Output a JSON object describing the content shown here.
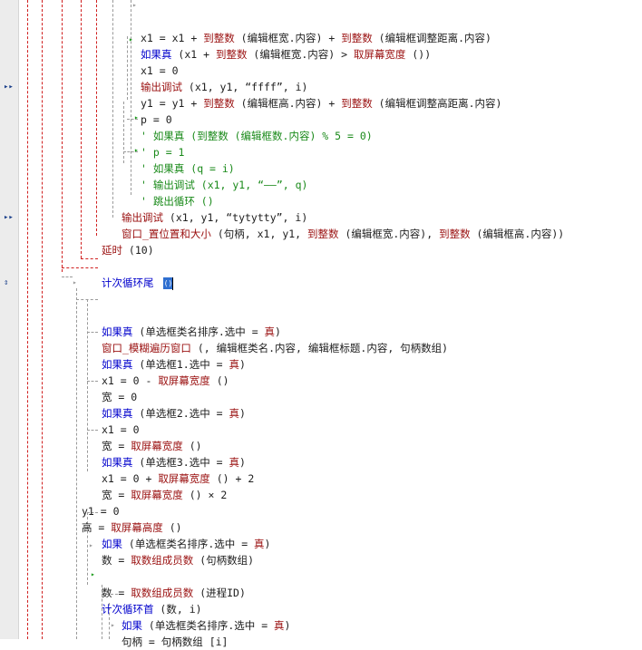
{
  "editor": {
    "gutter_markers": [
      {
        "row": 4,
        "icon": "run-marker-icon",
        "glyph": "▸▸"
      },
      {
        "row": 12,
        "icon": "run-marker-icon",
        "glyph": "▸▸"
      },
      {
        "row": 16,
        "icon": "cursor-line-marker-icon",
        "glyph": "⇕"
      }
    ],
    "lines": [
      {
        "id": "l0",
        "indent": 155,
        "parts": [
          {
            "c": "t",
            "v": ""
          }
        ]
      },
      {
        "id": "l1",
        "indent": 155,
        "parts": [
          {
            "c": "t",
            "v": "x1 = x1 + "
          },
          {
            "c": "f",
            "v": "到整数"
          },
          {
            "c": "t",
            "v": " (编辑框宽.内容) + "
          },
          {
            "c": "f",
            "v": "到整数"
          },
          {
            "c": "t",
            "v": " (编辑框调整距离.内容)"
          }
        ]
      },
      {
        "id": "l2",
        "indent": 155,
        "parts": [
          {
            "c": "k",
            "v": "如果真"
          },
          {
            "c": "t",
            "v": " (x1 + "
          },
          {
            "c": "f",
            "v": "到整数"
          },
          {
            "c": "t",
            "v": " (编辑框宽.内容) > "
          },
          {
            "c": "f",
            "v": "取屏幕宽度"
          },
          {
            "c": "t",
            "v": " ())"
          }
        ]
      },
      {
        "id": "l3",
        "indent": 155,
        "parts": [
          {
            "c": "t",
            "v": "x1 = 0"
          }
        ]
      },
      {
        "id": "l4",
        "indent": 155,
        "parts": [
          {
            "c": "f",
            "v": "输出调试"
          },
          {
            "c": "t",
            "v": " (x1, y1, “ffff”, i)"
          }
        ]
      },
      {
        "id": "l5",
        "indent": 155,
        "parts": [
          {
            "c": "t",
            "v": "y1 = y1 + "
          },
          {
            "c": "f",
            "v": "到整数"
          },
          {
            "c": "t",
            "v": " (编辑框高.内容) + "
          },
          {
            "c": "f",
            "v": "到整数"
          },
          {
            "c": "t",
            "v": " (编辑框调整高距离.内容)"
          }
        ]
      },
      {
        "id": "l6",
        "indent": 155,
        "parts": [
          {
            "c": "t",
            "v": "p = 0"
          }
        ]
      },
      {
        "id": "l7",
        "indent": 155,
        "parts": [
          {
            "c": "c",
            "v": "' 如果真 (到整数 (编辑框数.内容) % 5 = 0)"
          }
        ]
      },
      {
        "id": "l8",
        "indent": 155,
        "parts": [
          {
            "c": "c",
            "v": "' p = 1"
          }
        ]
      },
      {
        "id": "l9",
        "indent": 155,
        "parts": [
          {
            "c": "c",
            "v": "' 如果真 (q = i)"
          }
        ]
      },
      {
        "id": "l10",
        "indent": 155,
        "parts": [
          {
            "c": "c",
            "v": "' 输出调试 (x1, y1, “——”, q)"
          }
        ]
      },
      {
        "id": "l11",
        "indent": 155,
        "parts": [
          {
            "c": "c",
            "v": "' 跳出循环 ()"
          }
        ]
      },
      {
        "id": "l12",
        "indent": 134,
        "parts": [
          {
            "c": "f",
            "v": "输出调试"
          },
          {
            "c": "t",
            "v": " (x1, y1, “tytytty”, i)"
          }
        ]
      },
      {
        "id": "l13",
        "indent": 134,
        "parts": [
          {
            "c": "f",
            "v": "窗口_置位置和大小"
          },
          {
            "c": "t",
            "v": " (句柄, x1, y1, "
          },
          {
            "c": "f",
            "v": "到整数"
          },
          {
            "c": "t",
            "v": " (编辑框宽.内容), "
          },
          {
            "c": "f",
            "v": "到整数"
          },
          {
            "c": "t",
            "v": " (编辑框高.内容))"
          }
        ]
      },
      {
        "id": "l14",
        "indent": 112,
        "parts": [
          {
            "c": "f",
            "v": "延时"
          },
          {
            "c": "t",
            "v": " (10)"
          }
        ]
      },
      {
        "id": "l15",
        "indent": 112,
        "parts": [
          {
            "c": "t",
            "v": ""
          }
        ]
      },
      {
        "id": "l16",
        "indent": 112,
        "parts": [
          {
            "c": "k",
            "v": "计次循环尾"
          },
          {
            "c": "t",
            "v": " "
          }
        ],
        "cursor": true
      },
      {
        "id": "l17",
        "indent": 112,
        "parts": [
          {
            "c": "t",
            "v": ""
          }
        ]
      },
      {
        "id": "l18",
        "indent": 112,
        "parts": [
          {
            "c": "t",
            "v": ""
          }
        ]
      },
      {
        "id": "l19",
        "indent": 112,
        "parts": [
          {
            "c": "k",
            "v": "如果真"
          },
          {
            "c": "t",
            "v": " (单选框类名排序.选中 = "
          },
          {
            "c": "f",
            "v": "真"
          },
          {
            "c": "t",
            "v": ")"
          }
        ]
      },
      {
        "id": "l20",
        "indent": 112,
        "parts": [
          {
            "c": "f",
            "v": "窗口_模糊遍历窗口"
          },
          {
            "c": "t",
            "v": " (, 编辑框类名.内容, 编辑框标题.内容, 句柄数组)"
          }
        ]
      },
      {
        "id": "l21",
        "indent": 112,
        "parts": [
          {
            "c": "k",
            "v": "如果真"
          },
          {
            "c": "t",
            "v": " (单选框1.选中 = "
          },
          {
            "c": "f",
            "v": "真"
          },
          {
            "c": "t",
            "v": ")"
          }
        ]
      },
      {
        "id": "l22",
        "indent": 112,
        "parts": [
          {
            "c": "t",
            "v": "x1 = 0 - "
          },
          {
            "c": "f",
            "v": "取屏幕宽度"
          },
          {
            "c": "t",
            "v": " ()"
          }
        ]
      },
      {
        "id": "l23",
        "indent": 112,
        "parts": [
          {
            "c": "t",
            "v": "宽 = 0"
          }
        ]
      },
      {
        "id": "l24",
        "indent": 112,
        "parts": [
          {
            "c": "k",
            "v": "如果真"
          },
          {
            "c": "t",
            "v": " (单选框2.选中 = "
          },
          {
            "c": "f",
            "v": "真"
          },
          {
            "c": "t",
            "v": ")"
          }
        ]
      },
      {
        "id": "l25",
        "indent": 112,
        "parts": [
          {
            "c": "t",
            "v": "x1 = 0"
          }
        ]
      },
      {
        "id": "l26",
        "indent": 112,
        "parts": [
          {
            "c": "t",
            "v": "宽 = "
          },
          {
            "c": "f",
            "v": "取屏幕宽度"
          },
          {
            "c": "t",
            "v": " ()"
          }
        ]
      },
      {
        "id": "l27",
        "indent": 112,
        "parts": [
          {
            "c": "k",
            "v": "如果真"
          },
          {
            "c": "t",
            "v": " (单选框3.选中 = "
          },
          {
            "c": "f",
            "v": "真"
          },
          {
            "c": "t",
            "v": ")"
          }
        ]
      },
      {
        "id": "l28",
        "indent": 112,
        "parts": [
          {
            "c": "t",
            "v": "x1 = 0 + "
          },
          {
            "c": "f",
            "v": "取屏幕宽度"
          },
          {
            "c": "t",
            "v": " () + 2"
          }
        ]
      },
      {
        "id": "l29",
        "indent": 112,
        "parts": [
          {
            "c": "t",
            "v": "宽 = "
          },
          {
            "c": "f",
            "v": "取屏幕宽度"
          },
          {
            "c": "t",
            "v": " () × 2"
          }
        ]
      },
      {
        "id": "l30",
        "indent": 90,
        "parts": [
          {
            "c": "t",
            "v": "y1 = 0"
          }
        ]
      },
      {
        "id": "l31",
        "indent": 90,
        "parts": [
          {
            "c": "t",
            "v": "高 = "
          },
          {
            "c": "f",
            "v": "取屏幕高度"
          },
          {
            "c": "t",
            "v": " ()"
          }
        ]
      },
      {
        "id": "l32",
        "indent": 112,
        "parts": [
          {
            "c": "k",
            "v": "如果"
          },
          {
            "c": "t",
            "v": " (单选框类名排序.选中 = "
          },
          {
            "c": "f",
            "v": "真"
          },
          {
            "c": "t",
            "v": ")"
          }
        ]
      },
      {
        "id": "l33",
        "indent": 112,
        "parts": [
          {
            "c": "t",
            "v": "数 = "
          },
          {
            "c": "f",
            "v": "取数组成员数"
          },
          {
            "c": "t",
            "v": " (句柄数组)"
          }
        ]
      },
      {
        "id": "l34",
        "indent": 112,
        "parts": [
          {
            "c": "t",
            "v": ""
          }
        ]
      },
      {
        "id": "l35",
        "indent": 112,
        "parts": [
          {
            "c": "t",
            "v": "数 = "
          },
          {
            "c": "f",
            "v": "取数组成员数"
          },
          {
            "c": "t",
            "v": " (进程ID)"
          }
        ]
      },
      {
        "id": "l36",
        "indent": 112,
        "parts": [
          {
            "c": "k",
            "v": "计次循环首"
          },
          {
            "c": "t",
            "v": " (数, i)"
          }
        ]
      },
      {
        "id": "l37",
        "indent": 134,
        "parts": [
          {
            "c": "k",
            "v": "如果"
          },
          {
            "c": "t",
            "v": " (单选框类名排序.选中 = "
          },
          {
            "c": "f",
            "v": "真"
          },
          {
            "c": "t",
            "v": ")"
          }
        ]
      },
      {
        "id": "l38",
        "indent": 134,
        "parts": [
          {
            "c": "t",
            "v": "句柄 = 句柄数组 [i]"
          }
        ]
      }
    ],
    "cursor_char": "()"
  }
}
